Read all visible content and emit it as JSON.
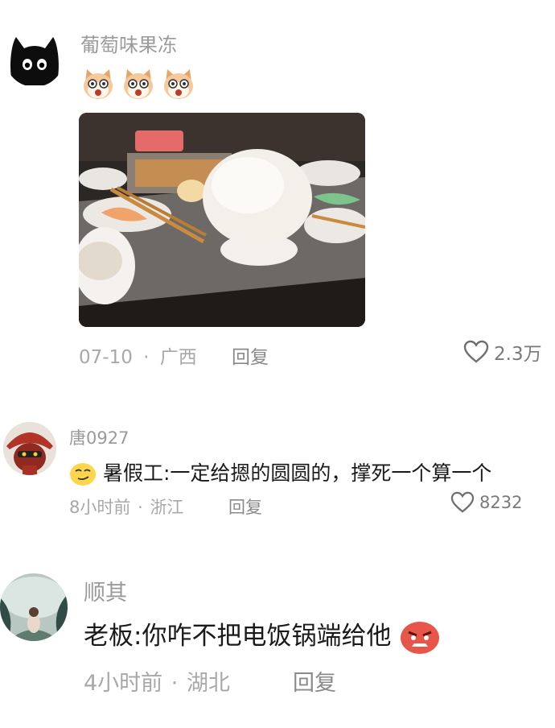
{
  "comments": [
    {
      "username": "葡萄味果冻",
      "avatar_icon": "black-cat-avatar",
      "emoji_icon": "crying-cat-emoji",
      "emoji_count": 3,
      "image_alt": "hotpot-table-rice-mound-photo",
      "date": "07-10",
      "separator": "·",
      "location": "广西",
      "reply_label": "回复",
      "likes": "2.3万"
    },
    {
      "username": "唐0927",
      "avatar_icon": "red-helmet-character-avatar",
      "emoji_icon": "smirk-face-emoji",
      "text": "暑假工:一定给摁的圆圆的，撑死一个算一个",
      "time": "8小时前",
      "separator": "·",
      "location": "浙江",
      "reply_label": "回复",
      "likes": "8232"
    },
    {
      "username": "顺其",
      "avatar_icon": "cave-photo-avatar",
      "emoji_icon": "angry-face-emoji",
      "text": "老板:你咋不把电饭锅端给他",
      "time": "4小时前",
      "separator": "·",
      "location": "湖北",
      "reply_label": "回复"
    }
  ],
  "colors": {
    "meta": "#a8a8a8",
    "username": "#9a9a9a",
    "text": "#1a1a1a"
  }
}
